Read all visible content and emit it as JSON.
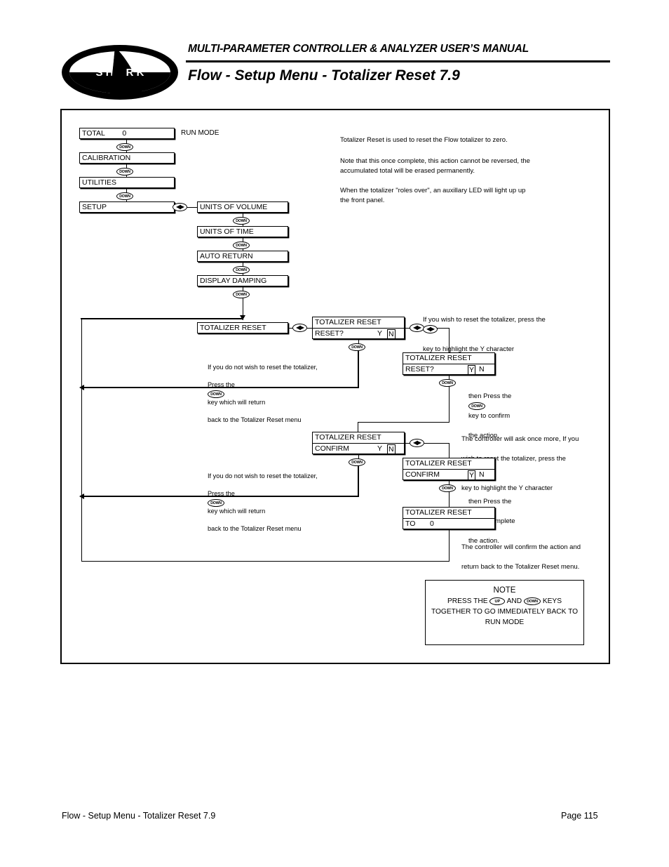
{
  "header": {
    "manual_title": "MULTI-PARAMETER CONTROLLER & ANALYZER USER’S MANUAL",
    "page_title": "Flow - Setup Menu - Totalizer Reset 7.9",
    "logo_text": "S H A R K"
  },
  "keys": {
    "down": "DOWN",
    "up": "UP",
    "leftright": "◀▶"
  },
  "diagram": {
    "run_mode_label": "RUN MODE",
    "main_menu": [
      {
        "label": "TOTAL",
        "value": "0"
      },
      {
        "label": "CALIBRATION",
        "value": ""
      },
      {
        "label": "UTILITIES",
        "value": ""
      },
      {
        "label": "SETUP",
        "value": ""
      }
    ],
    "setup_submenu": [
      {
        "label": "UNITS OF VOLUME"
      },
      {
        "label": "UNITS OF TIME"
      },
      {
        "label": "AUTO RETURN"
      },
      {
        "label": "DISPLAY DAMPING"
      },
      {
        "label": "TOTALIZER RESET"
      }
    ],
    "screens": {
      "reset_n": {
        "title": "TOTALIZER RESET",
        "prompt": "RESET?",
        "yes": "Y",
        "no": "N",
        "selected": "N"
      },
      "reset_y": {
        "title": "TOTALIZER RESET",
        "prompt": "RESET?",
        "yes": "Y",
        "no": "N",
        "selected": "Y"
      },
      "confirm_n": {
        "title": "TOTALIZER RESET",
        "prompt": "CONFIRM",
        "yes": "Y",
        "no": "N",
        "selected": "N"
      },
      "confirm_y": {
        "title": "TOTALIZER RESET",
        "prompt": "CONFIRM",
        "yes": "Y",
        "no": "N",
        "selected": "Y"
      },
      "done": {
        "title": "TOTALIZER RESET",
        "prompt": "TO",
        "value": "0"
      }
    }
  },
  "description": {
    "p1": "Totalizer Reset is used to reset the Flow totalizer to zero.",
    "p2": "Note that this once complete, this action cannot be reversed, the\naccumulated total will be erased permanently.",
    "p3": "When the totalizer \"roles over\", an auxillary LED will light up up\nthe front panel."
  },
  "annotations": {
    "reset_yes_1": "If you wish to reset the totalizer, press the",
    "reset_yes_2": "key to highlight the Y character",
    "no_reset_a1": "If you do not wish to reset the totalizer,",
    "no_reset_a2": "Press the",
    "no_reset_a3": "key which will return",
    "no_reset_a4": "back to the Totalizer Reset menu",
    "confirm_press_1": "then Press the",
    "confirm_press_2": "key to confirm",
    "confirm_press_3": "the action.",
    "confirm_ask_1": "The controller will ask once more, If you",
    "confirm_ask_2": "wish to reset the totalizer, press the",
    "confirm_ask_3": "key to highlight the Y character",
    "complete_press_1": "then Press the",
    "complete_press_2": "key to complete",
    "complete_press_3": "the action.",
    "final_1": "The controller will confirm the action and",
    "final_2": "return back to the Totalizer Reset menu."
  },
  "note": {
    "title": "NOTE",
    "line1_a": "PRESS THE",
    "line1_b": "AND",
    "line1_c": "KEYS",
    "line2": "TOGETHER TO GO IMMEDIATELY BACK TO",
    "line3": "RUN MODE"
  },
  "footer": {
    "left": "Flow - Setup Menu - Totalizer Reset 7.9",
    "right": "Page 115"
  }
}
